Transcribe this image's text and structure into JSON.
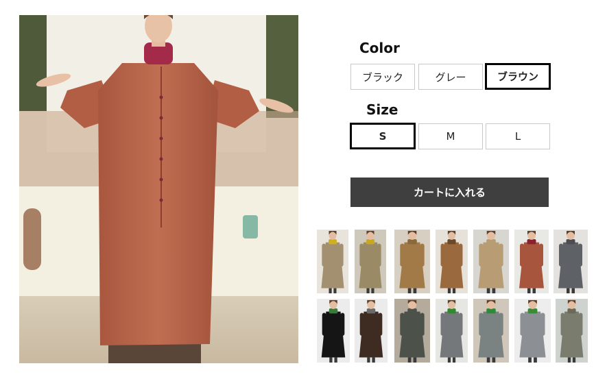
{
  "colors": {
    "title": "Color",
    "options": [
      "ブラック",
      "グレー",
      "ブラウン"
    ],
    "selected_index": 2
  },
  "sizes": {
    "title": "Size",
    "options": [
      "S",
      "M",
      "L"
    ],
    "selected_index": 0
  },
  "cart": {
    "label": "カートに入れる"
  },
  "thumbnails": [
    {
      "coat": "#a39070",
      "bg": "#e8e4dc",
      "scarf": "#d0b020"
    },
    {
      "coat": "#9a8a66",
      "bg": "#cfc9bc",
      "scarf": "#c9a820"
    },
    {
      "coat": "#a27a48",
      "bg": "#d6cfc2",
      "scarf": "#8a6a3a"
    },
    {
      "coat": "#9a6a3e",
      "bg": "#e6e2da",
      "scarf": "#6a4a2a"
    },
    {
      "coat": "#b89c74",
      "bg": "#d8d6d0",
      "scarf": "#b89c74"
    },
    {
      "coat": "#a8553e",
      "bg": "#e8e8e4",
      "scarf": "#8a2030"
    },
    {
      "coat": "#5e6266",
      "bg": "#e4e2de",
      "scarf": "#4a4e52"
    },
    {
      "coat": "#151515",
      "bg": "#ececec",
      "scarf": "#3a7a3a"
    },
    {
      "coat": "#3e2c22",
      "bg": "#ebebeb",
      "scarf": "#6a6a6a"
    },
    {
      "coat": "#4c524a",
      "bg": "#b4ab9c",
      "scarf": "#4c524a"
    },
    {
      "coat": "#74787a",
      "bg": "#e6e6e2",
      "scarf": "#2e8a2e"
    },
    {
      "coat": "#7a8282",
      "bg": "#cfc7ba",
      "scarf": "#2e8a3a"
    },
    {
      "coat": "#8c9094",
      "bg": "#ededed",
      "scarf": "#3a8a3a"
    },
    {
      "coat": "#7a7d6e",
      "bg": "#cfd3d0",
      "scarf": "#6a6a5a"
    }
  ]
}
